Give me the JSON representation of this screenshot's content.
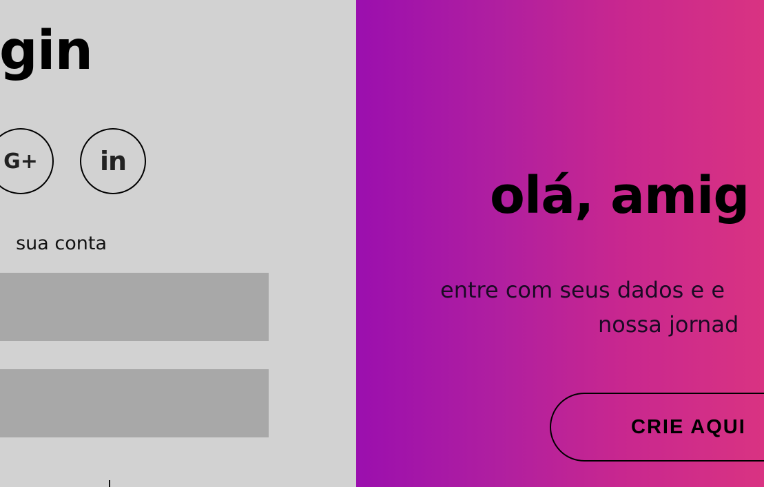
{
  "login": {
    "title": "gin",
    "social": [
      {
        "label": "G+",
        "icon": "google-plus-icon"
      },
      {
        "label": "in",
        "icon": "linkedin-icon"
      }
    ],
    "hint": "sua conta",
    "fields": [
      {
        "value": "",
        "placeholder": ""
      },
      {
        "value": "",
        "placeholder": ""
      }
    ]
  },
  "welcome": {
    "title": "olá, amig",
    "subtitle_line1": "entre com seus dados e e",
    "subtitle_line2": "nossa jornad",
    "button_label": "CRIE AQUI"
  },
  "colors": {
    "left_bg": "#d2d2d2",
    "field_bg": "#a8a8a8",
    "gradient_start": "#9b0fae",
    "gradient_end": "#d93382"
  }
}
